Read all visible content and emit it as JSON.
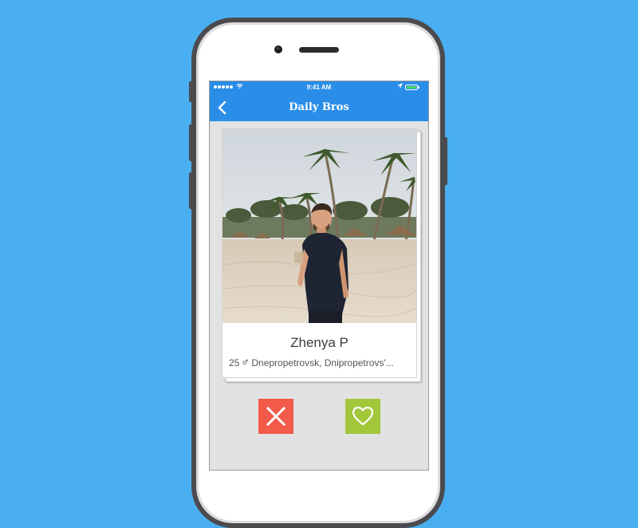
{
  "status_bar": {
    "time": "9:41 AM"
  },
  "nav": {
    "title": "Daily Bros"
  },
  "profile": {
    "name": "Zhenya P",
    "age": "25",
    "location": "Dnepropetrovsk, Dnipropetrovs'..."
  },
  "icons": {
    "back": "chevron-left-icon",
    "gender": "male-symbol-icon",
    "reject": "close-icon",
    "like": "heart-icon"
  },
  "colors": {
    "background": "#4aaff0",
    "nav_bar": "#2a8ee8",
    "reject": "#f25a4a",
    "like": "#a2c73b",
    "battery": "#4cd964"
  }
}
